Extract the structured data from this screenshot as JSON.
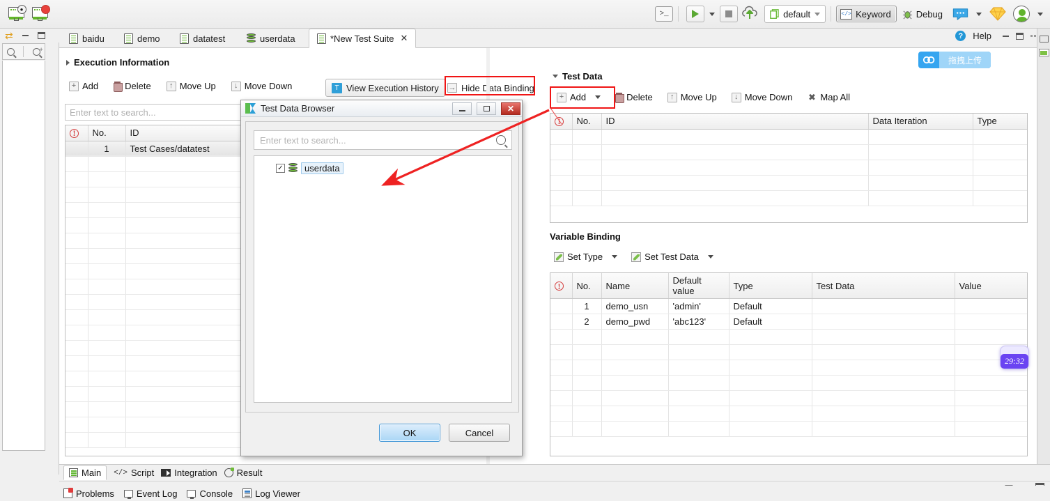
{
  "toolbar": {
    "record_web_label": "record-web",
    "record_mobile_label": "record-mobile",
    "console_label": ">_",
    "run_label": "Run",
    "stop_label": "Stop",
    "upload_label": "Upload",
    "profile": "default",
    "keyword_label": "Keyword",
    "debug_label": "Debug",
    "comment_label": "Comment",
    "plugin_label": "Plugin",
    "account_label": "Account"
  },
  "help": {
    "label": "Help"
  },
  "tabs": [
    {
      "label": "baidu",
      "icon": "test-case-icon",
      "active": false,
      "close": ""
    },
    {
      "label": "demo",
      "icon": "test-case-icon",
      "active": false,
      "close": ""
    },
    {
      "label": "datatest",
      "icon": "test-case-icon",
      "active": false,
      "close": ""
    },
    {
      "label": "userdata",
      "icon": "database-icon",
      "active": false,
      "close": ""
    },
    {
      "label": "*New Test Suite",
      "icon": "test-suite-icon",
      "active": true,
      "close": "✕"
    }
  ],
  "execution": {
    "section_title": "Execution Information",
    "toolbar": {
      "add": "Add",
      "delete": "Delete",
      "move_up": "Move Up",
      "move_down": "Move Down",
      "view_history": "View Execution History",
      "hide_data_binding": "Hide Data Binding"
    },
    "search_placeholder": "Enter text to search...",
    "columns": [
      "",
      "No.",
      "ID"
    ],
    "rows": [
      {
        "no": "1",
        "id": "Test Cases/datatest"
      }
    ]
  },
  "test_data": {
    "section_title": "Test Data",
    "toolbar": {
      "add": "Add",
      "delete": "Delete",
      "move_up": "Move Up",
      "move_down": "Move Down",
      "map_all": "Map All"
    },
    "columns": [
      "",
      "No.",
      "ID",
      "Data Iteration",
      "Type"
    ],
    "rows": []
  },
  "variable_binding": {
    "section_title": "Variable Binding",
    "toolbar": {
      "set_type": "Set Type",
      "set_test_data": "Set Test Data"
    },
    "columns": [
      "",
      "No.",
      "Name",
      "Default value",
      "Type",
      "Test Data",
      "Value"
    ],
    "rows": [
      {
        "no": "1",
        "name": "demo_usn",
        "default_value": "'admin'",
        "type": "Default",
        "test_data": "",
        "value": ""
      },
      {
        "no": "2",
        "name": "demo_pwd",
        "default_value": "'abc123'",
        "type": "Default",
        "test_data": "",
        "value": ""
      }
    ]
  },
  "dialog": {
    "title": "Test Data Browser",
    "minimize": "–",
    "restore": "□",
    "close": "✕",
    "search_placeholder": "Enter text to search...",
    "tree": [
      {
        "label": "userdata",
        "checked": "✓",
        "icon": "database-icon"
      }
    ],
    "ok": "OK",
    "cancel": "Cancel"
  },
  "editor_tabs": [
    {
      "label": "Main",
      "icon": "main-icon",
      "active": true
    },
    {
      "label": "Script",
      "icon": "script-icon",
      "active": false
    },
    {
      "label": "Integration",
      "icon": "integration-icon",
      "active": false
    },
    {
      "label": "Result",
      "icon": "result-icon",
      "active": false
    }
  ],
  "status_tabs": [
    {
      "label": "Problems",
      "icon": "problems-icon"
    },
    {
      "label": "Event Log",
      "icon": "event-log-icon"
    },
    {
      "label": "Console",
      "icon": "console-icon"
    },
    {
      "label": "Log Viewer",
      "icon": "log-viewer-icon"
    }
  ],
  "overlays": {
    "upload_widget_label": "拖拽上传",
    "timer": "29:32"
  },
  "colors": {
    "annotation_red": "#f01414",
    "accent_green": "#5aa832",
    "accent_blue": "#35a5f0",
    "timer_purple": "#6a44f2"
  }
}
